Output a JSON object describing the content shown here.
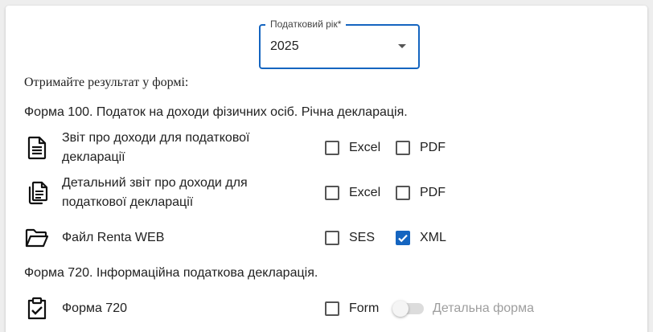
{
  "tax_year": {
    "label": "Податковий рік*",
    "value": "2025"
  },
  "intro": "Отримайте результат у формі:",
  "form100": {
    "title": "Форма 100. Податок на доходи фізичних осіб. Річна декларація.",
    "rows": [
      {
        "icon": "document-icon",
        "text": "Звіт про доходи для податкової декларації",
        "options": [
          {
            "label": "Excel",
            "checked": false
          },
          {
            "label": "PDF",
            "checked": false
          }
        ]
      },
      {
        "icon": "documents-copy-icon",
        "text": "Детальний звіт про доходи для податкової декларації",
        "options": [
          {
            "label": "Excel",
            "checked": false
          },
          {
            "label": "PDF",
            "checked": false
          }
        ]
      },
      {
        "icon": "folder-open-icon",
        "text": "Файл Renta WEB",
        "options": [
          {
            "label": "SES",
            "checked": false
          },
          {
            "label": "XML",
            "checked": true
          }
        ]
      }
    ]
  },
  "form720": {
    "title": "Форма 720. Інформаційна податкова декларація.",
    "rows": [
      {
        "icon": "clipboard-check-icon",
        "text": "Форма 720",
        "options": [
          {
            "label": "Form",
            "checked": false
          }
        ],
        "toggle": {
          "label": "Детальна форма",
          "on": false
        }
      }
    ]
  },
  "colors": {
    "accent": "#1565c0",
    "disabled": "#9e9e9e"
  }
}
